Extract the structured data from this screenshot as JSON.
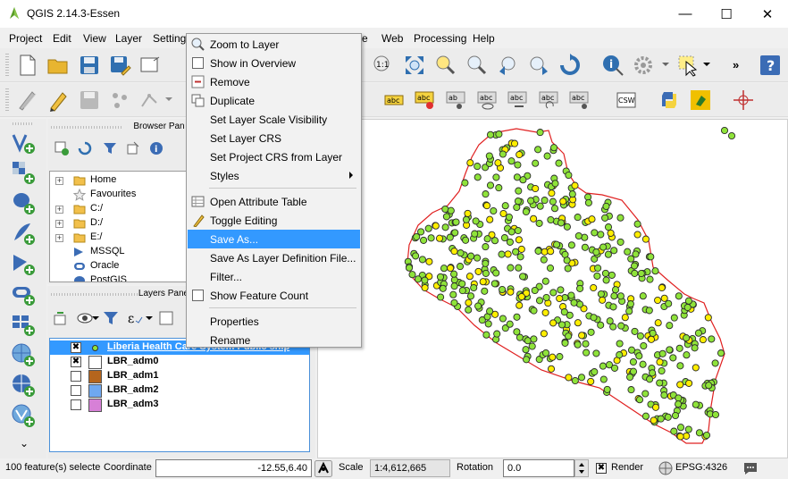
{
  "window": {
    "title": "QGIS 2.14.3-Essen",
    "minimize_glyph": "—",
    "maximize_glyph": "☐",
    "close_glyph": "✕"
  },
  "menubar": {
    "items": [
      "Project",
      "Edit",
      "View",
      "Layer",
      "Settings",
      "e",
      "Web",
      "Processing",
      "Help"
    ]
  },
  "browser_panel": {
    "title": "Browser Pan",
    "tree": [
      {
        "label": "Home",
        "icon": "folder-icon",
        "expandable": true
      },
      {
        "label": "Favourites",
        "icon": "star-icon",
        "expandable": false
      },
      {
        "label": "C:/",
        "icon": "folder-icon",
        "expandable": true
      },
      {
        "label": "D:/",
        "icon": "folder-icon",
        "expandable": true
      },
      {
        "label": "E:/",
        "icon": "folder-icon",
        "expandable": true
      },
      {
        "label": "MSSQL",
        "icon": "mssql-icon",
        "expandable": false
      },
      {
        "label": "Oracle",
        "icon": "oracle-icon",
        "expandable": false
      },
      {
        "label": "PostGIS",
        "icon": "postgis-icon",
        "expandable": false
      }
    ]
  },
  "layers_panel": {
    "title": "Layers Pane",
    "layers": [
      {
        "label": "Liberia Health Care System Public ship",
        "checked": true,
        "selected": true,
        "swatch": "point"
      },
      {
        "label": "LBR_adm0",
        "checked": true,
        "selected": false,
        "swatch": "#ffffff"
      },
      {
        "label": "LBR_adm1",
        "checked": false,
        "selected": false,
        "swatch": "#b5651d"
      },
      {
        "label": "LBR_adm2",
        "checked": false,
        "selected": false,
        "swatch": "#6fa8f0"
      },
      {
        "label": "LBR_adm3",
        "checked": false,
        "selected": false,
        "swatch": "#d780d7"
      }
    ]
  },
  "context_menu": {
    "items": [
      {
        "label": "Zoom to Layer",
        "icon": "zoom-icon"
      },
      {
        "label": "Show in Overview",
        "icon": "checkbox-icon"
      },
      {
        "label": "Remove",
        "icon": "remove-icon"
      },
      {
        "label": "Duplicate",
        "icon": "duplicate-icon"
      },
      {
        "label": "Set Layer Scale Visibility",
        "icon": ""
      },
      {
        "label": "Set Layer CRS",
        "icon": ""
      },
      {
        "label": "Set Project CRS from Layer",
        "icon": ""
      },
      {
        "label": "Styles",
        "icon": "",
        "submenu": true
      },
      {
        "separator": true
      },
      {
        "label": "Open Attribute Table",
        "icon": "table-icon"
      },
      {
        "label": "Toggle Editing",
        "icon": "pencil-icon"
      },
      {
        "label": "Save As...",
        "icon": "",
        "highlight": true
      },
      {
        "label": "Save As Layer Definition File...",
        "icon": ""
      },
      {
        "label": "Filter...",
        "icon": ""
      },
      {
        "label": "Show Feature Count",
        "icon": "checkbox-icon"
      },
      {
        "separator": true
      },
      {
        "label": "Properties",
        "icon": ""
      },
      {
        "label": "Rename",
        "icon": ""
      }
    ]
  },
  "statusbar": {
    "selection": "100 feature(s) selecte",
    "coordinate_label": "Coordinate",
    "coordinate_value": "-12.55,6.40",
    "scale_label": "Scale",
    "scale_value": "1:4,612,665",
    "rotation_label": "Rotation",
    "rotation_value": "0.0",
    "render_label": "Render",
    "render_checked": true,
    "crs": "EPSG:4326"
  },
  "colors": {
    "point_fill": "#8fe33a",
    "point_selected": "#ffee00",
    "boundary": "#e02020",
    "highlight": "#3399ff"
  }
}
